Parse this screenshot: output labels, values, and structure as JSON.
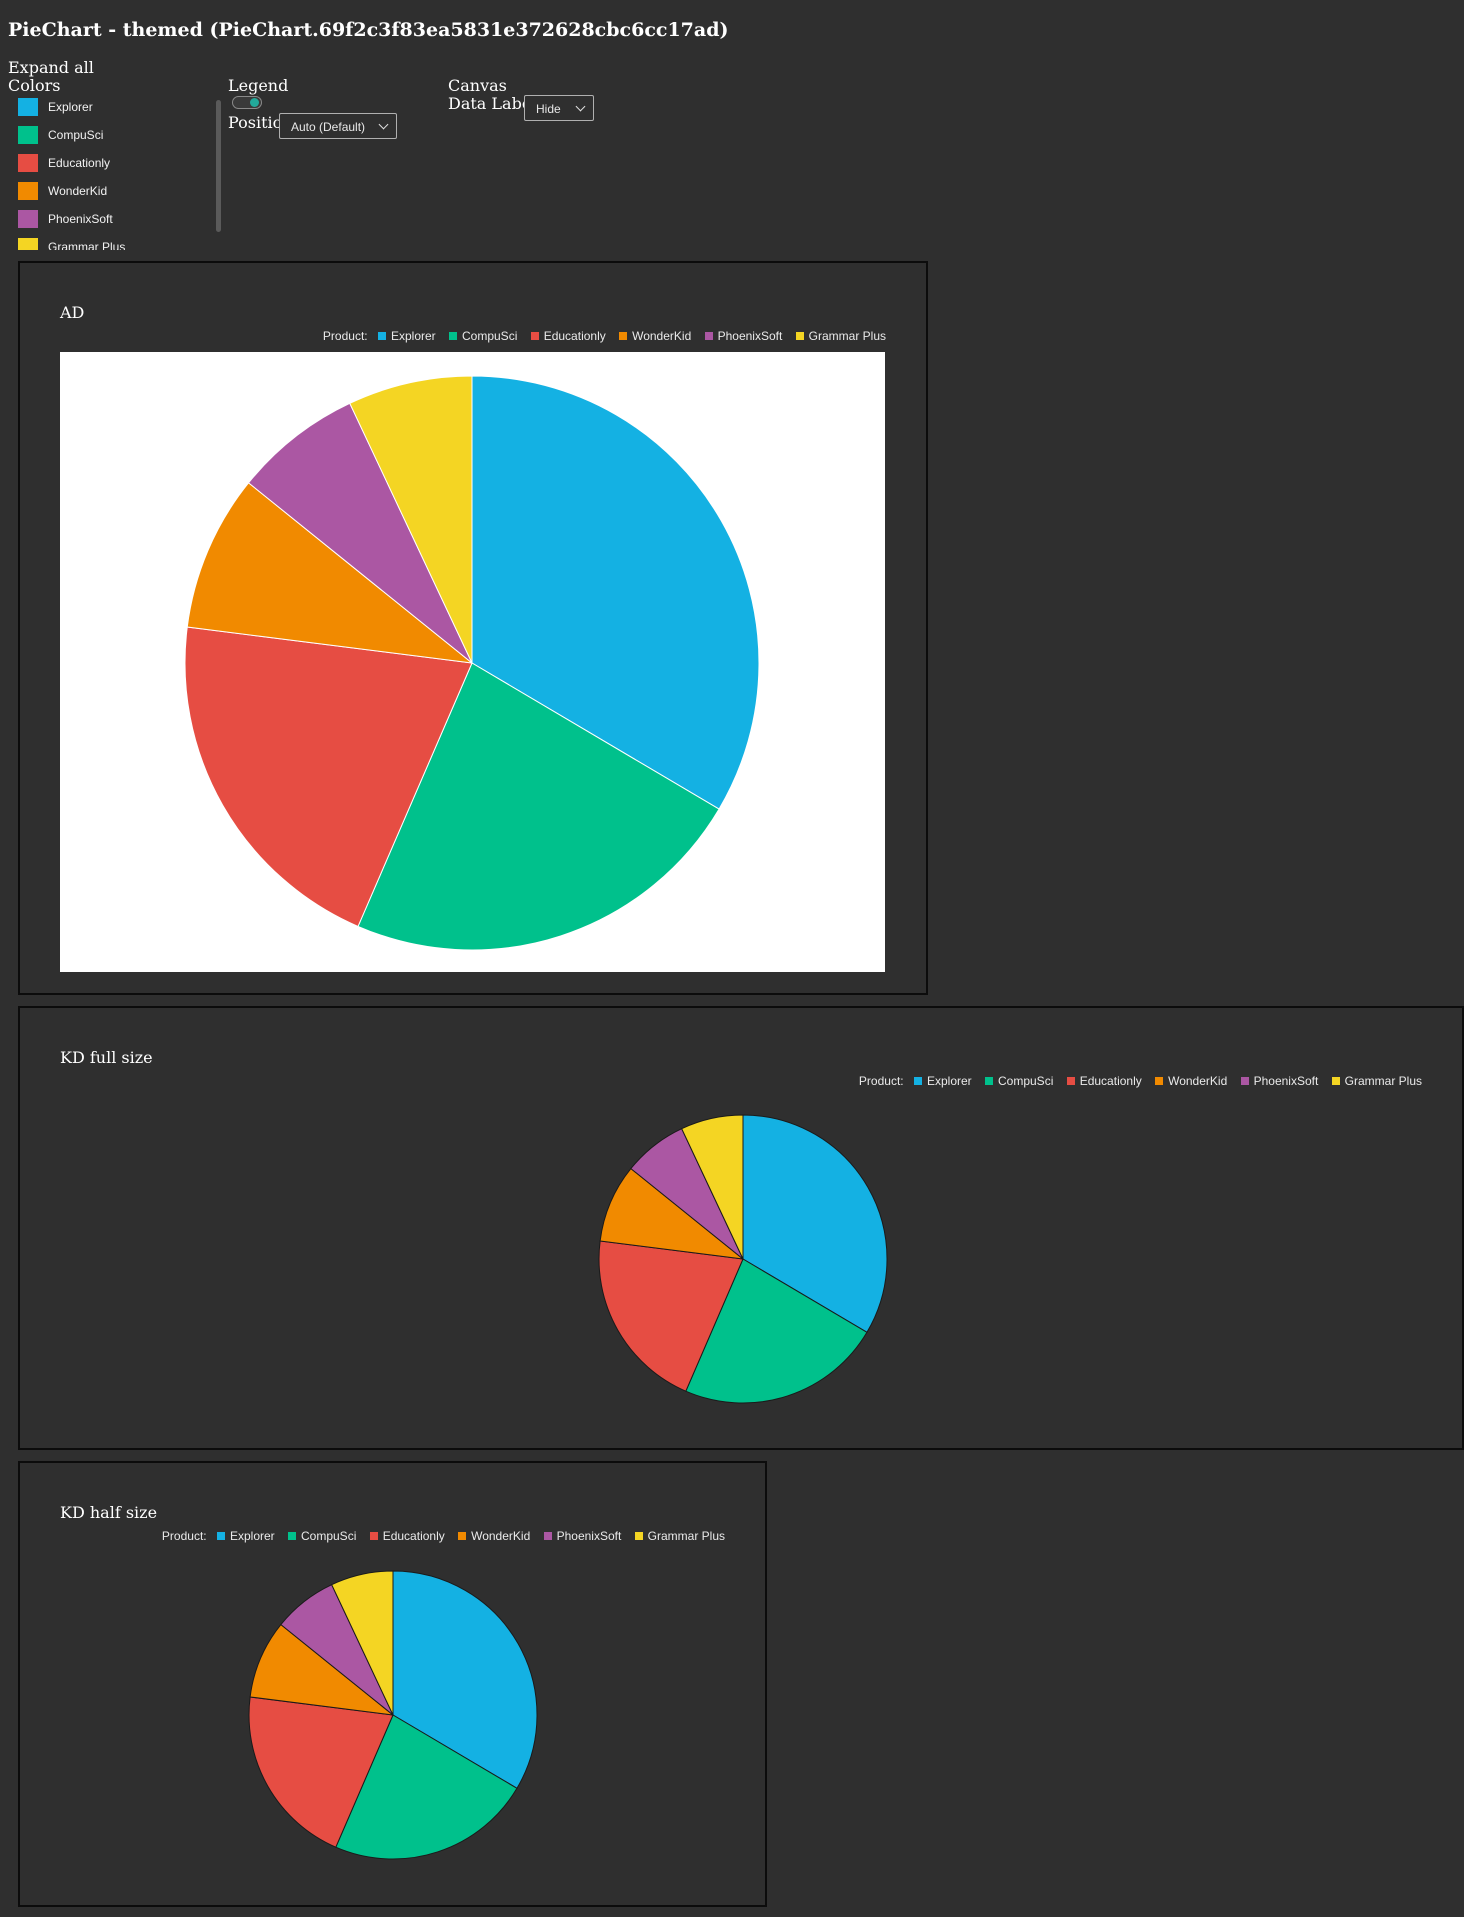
{
  "page": {
    "title": "PieChart - themed (PieChart.69f2c3f83ea5831e372628cbc6cc17ad)"
  },
  "controls": {
    "expand_all": "Expand all",
    "colors_label": "Colors",
    "legend_label": "Legend",
    "legend_toggle_on": true,
    "position_label": "Position",
    "position_value": "Auto (Default)",
    "canvas_label": "Canvas",
    "data_labels_label": "Data Labels",
    "data_labels_value": "Hide"
  },
  "palette": [
    {
      "name": "Explorer",
      "color": "#14b1e3"
    },
    {
      "name": "CompuSci",
      "color": "#00c18c"
    },
    {
      "name": "Educationly",
      "color": "#e64d43"
    },
    {
      "name": "WonderKid",
      "color": "#f18a00"
    },
    {
      "name": "PhoenixSoft",
      "color": "#ab57a3"
    },
    {
      "name": "Grammar Plus",
      "color": "#f4d523"
    }
  ],
  "charts": [
    {
      "id": "ad",
      "title": "AD",
      "legend_label": "Product:",
      "background": "#ffffff",
      "slice_stroke": "#ffffff"
    },
    {
      "id": "kd-full",
      "title": "KD full size",
      "legend_label": "Product:",
      "background": "none",
      "slice_stroke": "#1a1a1a"
    },
    {
      "id": "kd-half",
      "title": "KD half size",
      "legend_label": "Product:",
      "background": "none",
      "slice_stroke": "#1a1a1a"
    }
  ],
  "chart_data": [
    {
      "type": "pie",
      "title": "AD",
      "legend_title": "Product:",
      "categories": [
        "Explorer",
        "CompuSci",
        "Educationly",
        "WonderKid",
        "PhoenixSoft",
        "Grammar Plus"
      ],
      "values": [
        33.5,
        23.0,
        20.5,
        8.8,
        7.2,
        7.0
      ]
    },
    {
      "type": "pie",
      "title": "KD full size",
      "legend_title": "Product:",
      "categories": [
        "Explorer",
        "CompuSci",
        "Educationly",
        "WonderKid",
        "PhoenixSoft",
        "Grammar Plus"
      ],
      "values": [
        33.5,
        23.0,
        20.5,
        8.8,
        7.2,
        7.0
      ]
    },
    {
      "type": "pie",
      "title": "KD half size",
      "legend_title": "Product:",
      "categories": [
        "Explorer",
        "CompuSci",
        "Educationly",
        "WonderKid",
        "PhoenixSoft",
        "Grammar Plus"
      ],
      "values": [
        33.5,
        23.0,
        20.5,
        8.8,
        7.2,
        7.0
      ]
    }
  ]
}
